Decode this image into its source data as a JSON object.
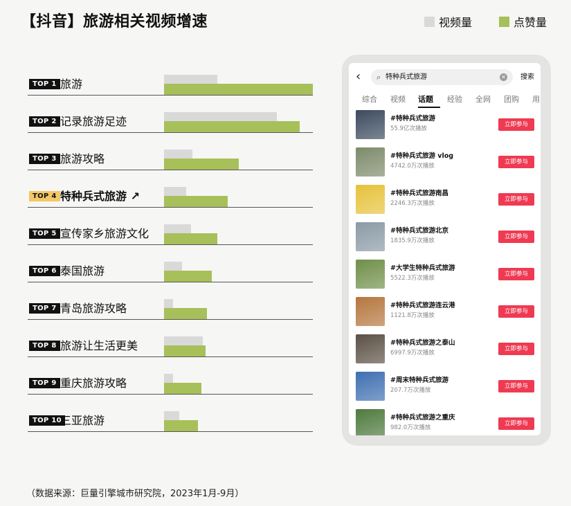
{
  "title": "【抖音】旅游相关视频增速",
  "legend": {
    "views_label": "视频量",
    "likes_label": "点赞量",
    "views_color": "#d9d9d9",
    "likes_color": "#a7c05a"
  },
  "chart_data": {
    "type": "bar",
    "orientation": "horizontal",
    "title": "【抖音】旅游相关视频增速",
    "ranks": [
      "TOP 1",
      "TOP 2",
      "TOP 3",
      "TOP 4",
      "TOP 5",
      "TOP 6",
      "TOP 7",
      "TOP 8",
      "TOP 9",
      "TOP 10"
    ],
    "categories": [
      "旅游",
      "记录旅游足迹",
      "旅游攻略",
      "特种兵式旅游",
      "宣传家乡旅游文化",
      "泰国旅游",
      "青岛旅游攻略",
      "旅游让生活更美",
      "重庆旅游攻略",
      "三亚旅游"
    ],
    "highlight_index": 3,
    "highlight_arrow": "↗",
    "value_scale": "relative (0–1 of widest bar); no value axis printed",
    "series": [
      {
        "name": "视频量",
        "color": "#d9d9d9",
        "values": [
          0.36,
          0.76,
          0.19,
          0.15,
          0.18,
          0.12,
          0.06,
          0.26,
          0.06,
          0.1
        ]
      },
      {
        "name": "点赞量",
        "color": "#a7c05a",
        "values": [
          1.0,
          0.91,
          0.5,
          0.43,
          0.36,
          0.32,
          0.29,
          0.28,
          0.25,
          0.23
        ]
      }
    ]
  },
  "phone": {
    "back_icon": "chevron-left",
    "search_query": "特种兵式旅游",
    "search_button": "搜索",
    "tabs": [
      "综合",
      "视频",
      "话题",
      "经验",
      "全网",
      "团购",
      "用"
    ],
    "active_tab": "话题",
    "join_label": "立即参与",
    "items": [
      {
        "title": "#特种兵式旅游",
        "count": "55.9亿次播放",
        "thumb": "#3b4a5e"
      },
      {
        "title": "#特种兵式旅游 vlog",
        "count": "4742.0万次播放",
        "thumb": "#7d8a6a"
      },
      {
        "title": "#特种兵式旅游南昌",
        "count": "2246.3万次播放",
        "thumb": "#e6c23a"
      },
      {
        "title": "#特种兵式旅游北京",
        "count": "1835.9万次播放",
        "thumb": "#8a9aa6"
      },
      {
        "title": "#大学生特种兵式旅游",
        "count": "5522.3万次播放",
        "thumb": "#6f8f48"
      },
      {
        "title": "#特种兵式旅游连云港",
        "count": "1121.8万次播放",
        "thumb": "#b5763e"
      },
      {
        "title": "#特种兵式旅游之泰山",
        "count": "6997.9万次播放",
        "thumb": "#5b5044"
      },
      {
        "title": "#周末特种兵式旅游",
        "count": "207.7万次播放",
        "thumb": "#3e6fb0"
      },
      {
        "title": "#特种兵式旅游之重庆",
        "count": "982.0万次播放",
        "thumb": "#4f7a3e"
      }
    ]
  },
  "source": "（数据来源：巨量引擎城市研究院，2023年1月-9月）"
}
